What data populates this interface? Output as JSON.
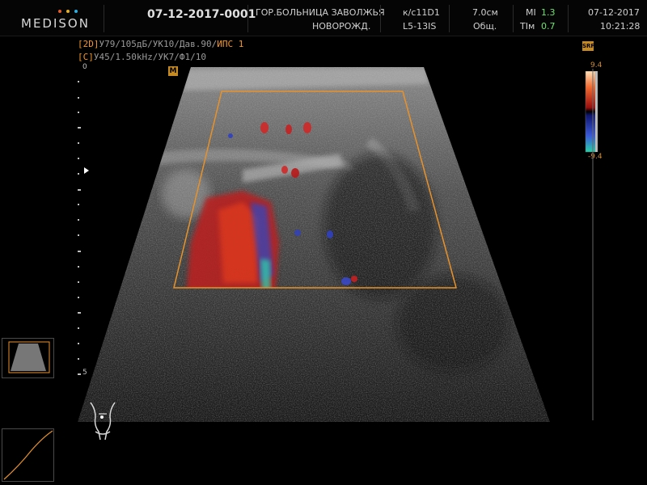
{
  "header": {
    "brand": "MEDISON",
    "brand_dot_colors": [
      "#e35d2a",
      "#e3b02a",
      "#2ab0e3"
    ],
    "patient_id": "07-12-2017-0001",
    "hospital": "ГОР.БОЛЬНИЦА ЗАВОЛЖЬЯ",
    "department": "НОВОРОЖД.",
    "preset": "к/с11D1",
    "probe": "L5-13IS",
    "depth": "7.0см",
    "app": "Общ.",
    "mi_label": "MI",
    "mi_value": "1.3",
    "tim_label": "TIм",
    "tim_value": "0.7",
    "date": "07-12-2017",
    "time": "10:21:28"
  },
  "params": {
    "mode_2d_tag": "[2D]",
    "mode_2d_text": "У79/105дБ/УК10/Дав.90/",
    "mode_2d_extra": "ИПС 1",
    "mode_c_tag": "[C]",
    "mode_c_text": "У45/1.50kHz/УК7/Ф1/10"
  },
  "depth_scale": {
    "top_label": "0",
    "bottom_label": "5"
  },
  "markers": {
    "m_label": "M",
    "srf_label": "SRF"
  },
  "color_bar": {
    "top_value": "9.4",
    "bottom_value": "-9.4",
    "colors": [
      "#ffd0a0",
      "#e8502a",
      "#a01010",
      "#000000",
      "#101870",
      "#3050d0",
      "#20c0a0"
    ]
  },
  "icons": {
    "body_mark": "body-mark-icon",
    "probe_thumb": "probe-thumbnail-icon",
    "gain_curve": "gain-curve-icon"
  }
}
